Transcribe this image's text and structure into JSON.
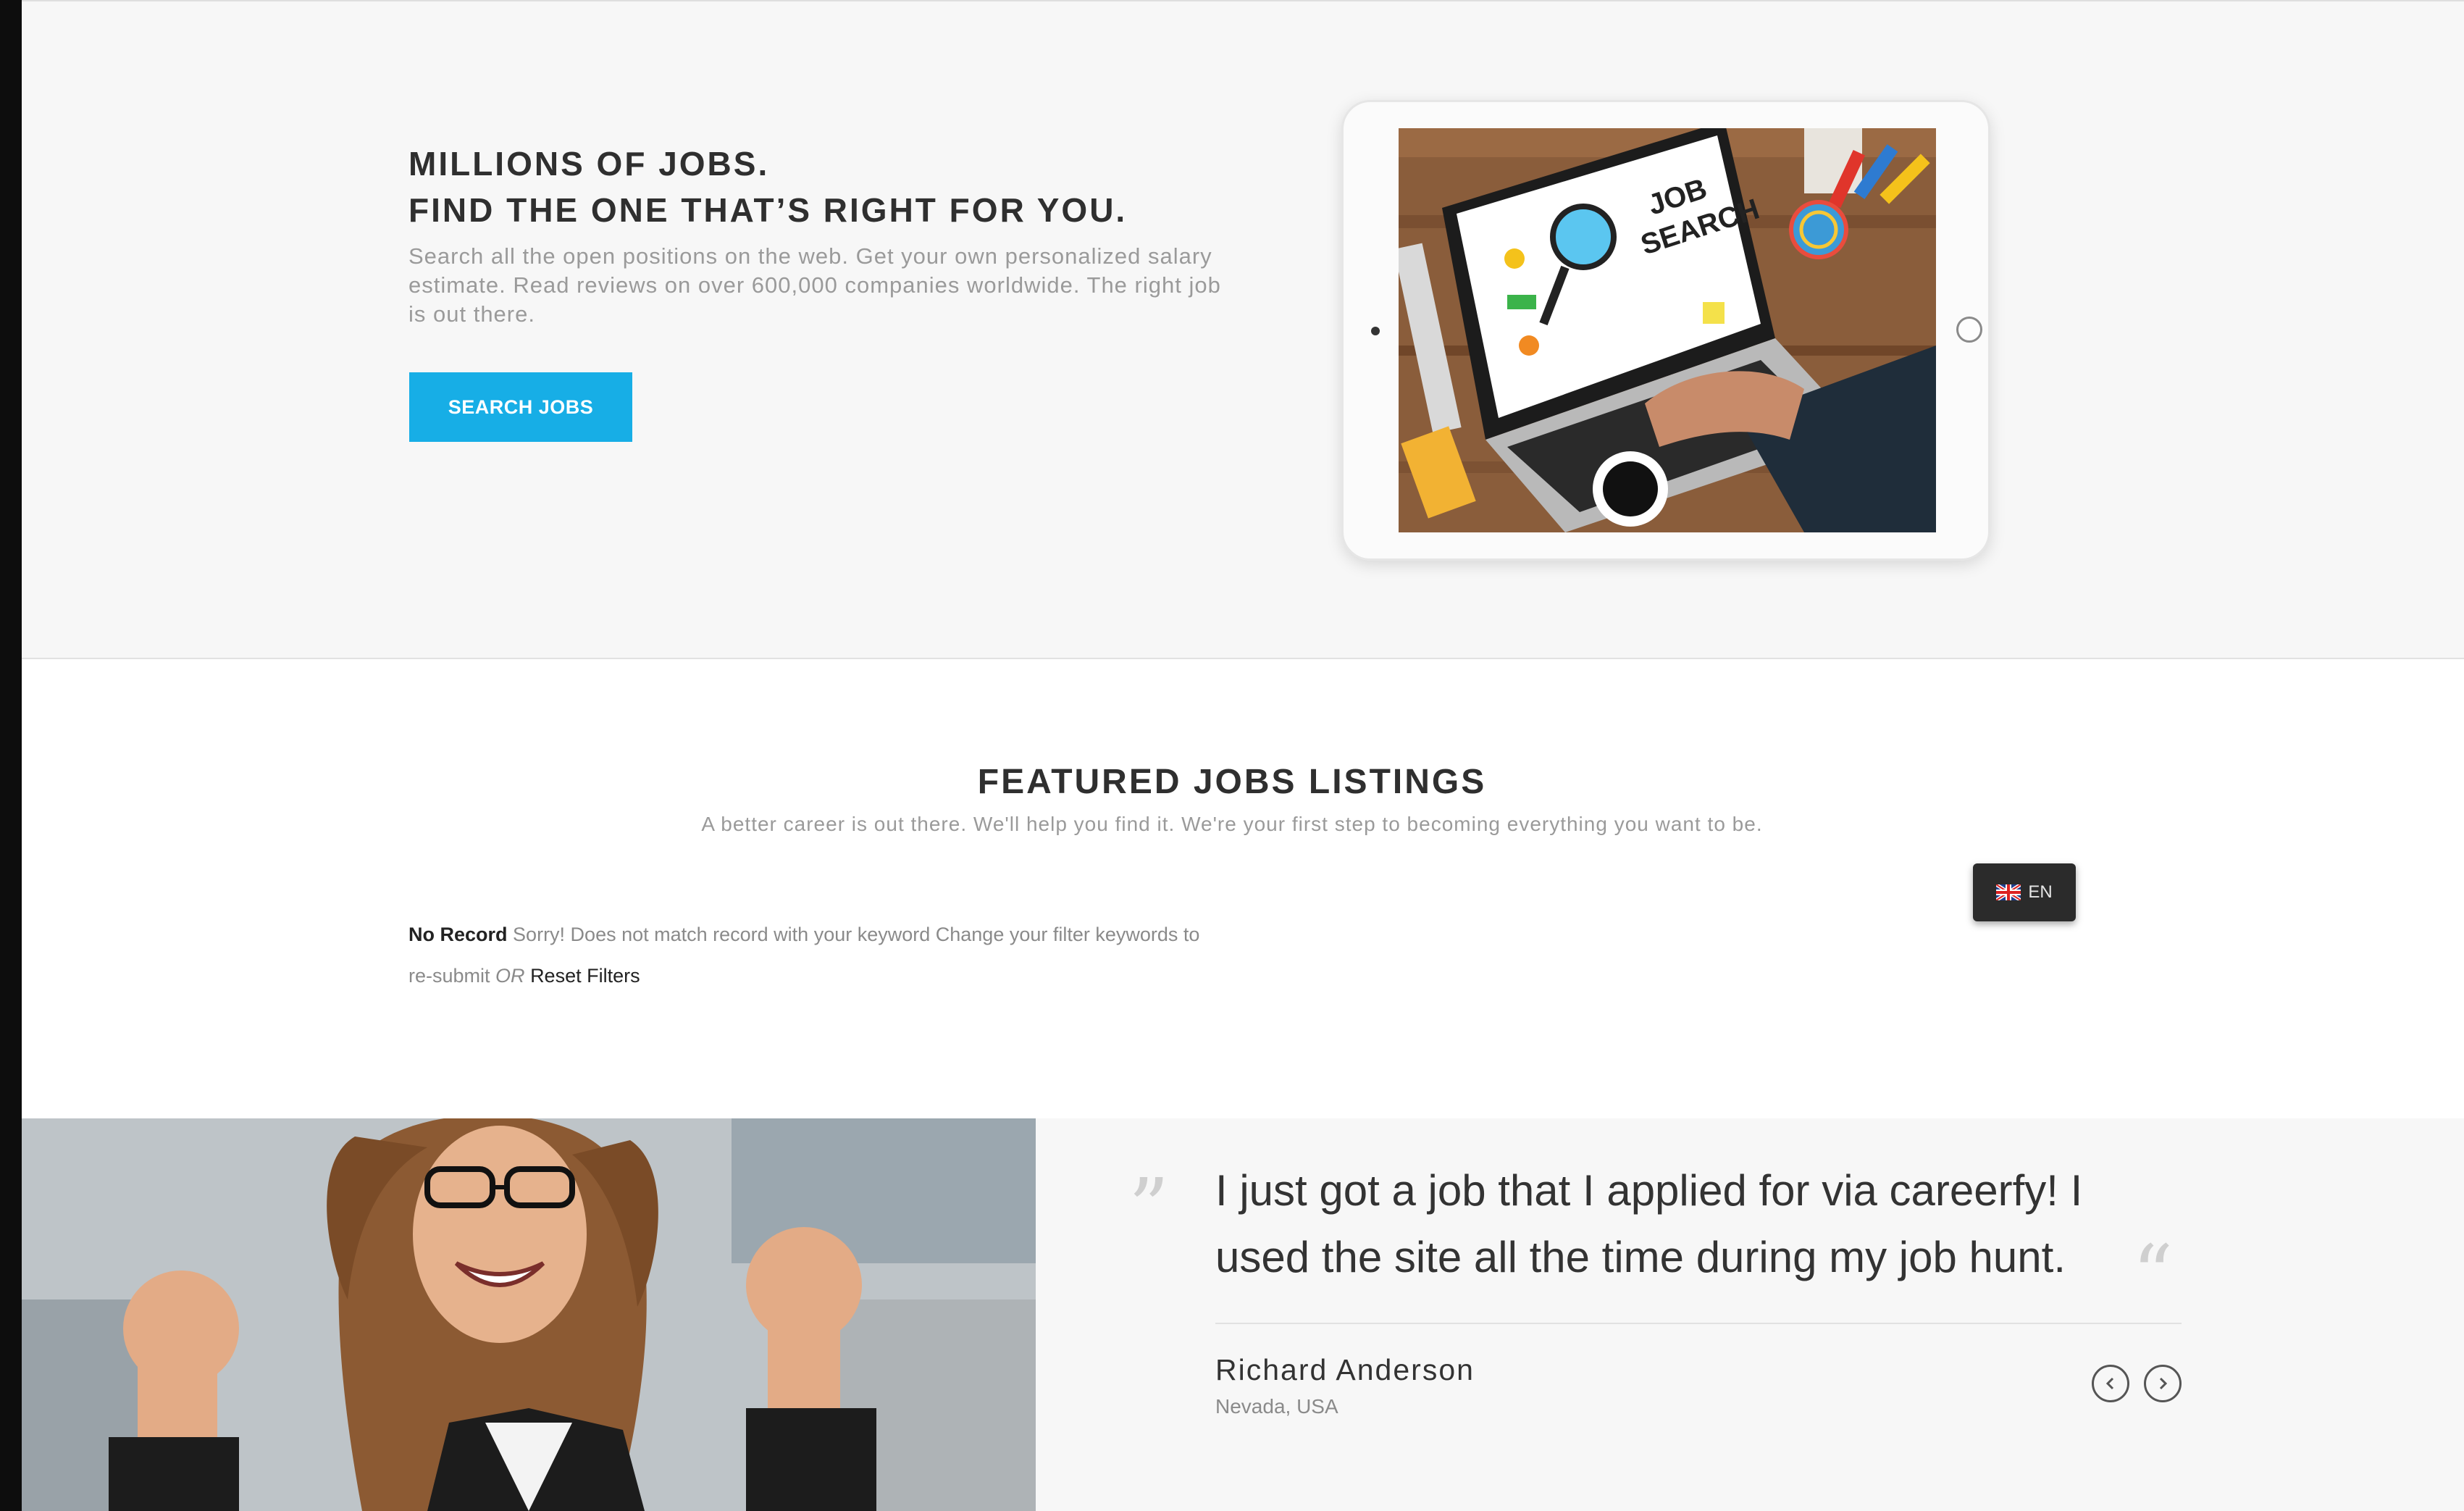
{
  "hero": {
    "heading_line1": "MILLIONS OF JOBS.",
    "heading_line2": "FIND THE ONE THAT’S RIGHT FOR YOU.",
    "description": "Search all the open positions on the web. Get your own personalized salary estimate. Read reviews on over 600,000 companies worldwide. The right job is out there.",
    "search_button_label": "SEARCH JOBS",
    "tablet_image": "laptop-job-search-photo",
    "accent_color": "#17aee6"
  },
  "featured": {
    "title": "FEATURED JOBS LISTINGS",
    "subtitle": "A better career is out there. We'll help you find it. We're your first step to becoming everything you want to be.",
    "no_record_label": "No Record",
    "no_record_message": "Sorry!  Does not match record with your keyword Change your filter keywords to re-submit",
    "or_label": "OR",
    "reset_link_label": "Reset Filters"
  },
  "language": {
    "code": "EN",
    "flag_icon": "uk-flag-icon"
  },
  "testimonial": {
    "quote": "I just got a job that I applied for via careerfy! I used the site all the time during my job hunt.",
    "open_quote_glyph": "”",
    "close_quote_glyph": "“",
    "author": "Richard Anderson",
    "location": "Nevada, USA",
    "prev_icon": "chevron-left-icon",
    "next_icon": "chevron-right-icon",
    "photo": "happy-woman-photo"
  }
}
